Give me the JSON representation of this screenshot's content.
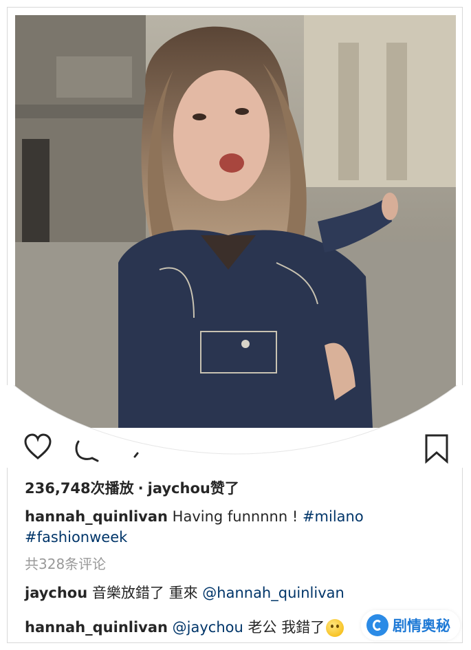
{
  "post": {
    "image_alt": "Woman in a denim jacket smiling on a street in Milan",
    "views_count": "236,748次播放",
    "separator": "·",
    "liked_by": "jaychou赞了",
    "caption": {
      "username": "hannah_quinlivan",
      "text": "Having funnnnn !",
      "hashtag_1": "#milano",
      "hashtag_2": "#fashionweek"
    },
    "comments_summary": "共328条评论",
    "comments": [
      {
        "username": "jaychou",
        "text": "音樂放錯了 重來",
        "mention": "@hannah_quinlivan"
      },
      {
        "username": "hannah_quinlivan",
        "mention": "@jaychou",
        "text": "老公 我錯了"
      }
    ]
  },
  "icons": {
    "like": "heart-icon",
    "comment": "comment-icon",
    "share": "share-icon",
    "save": "bookmark-icon",
    "emoji": "grinning-face-emoji"
  },
  "watermark": {
    "text": "剧情奥秘"
  },
  "colors": {
    "text": "#262626",
    "link": "#003569",
    "muted": "#999999",
    "watermark": "#1f7ad6"
  }
}
